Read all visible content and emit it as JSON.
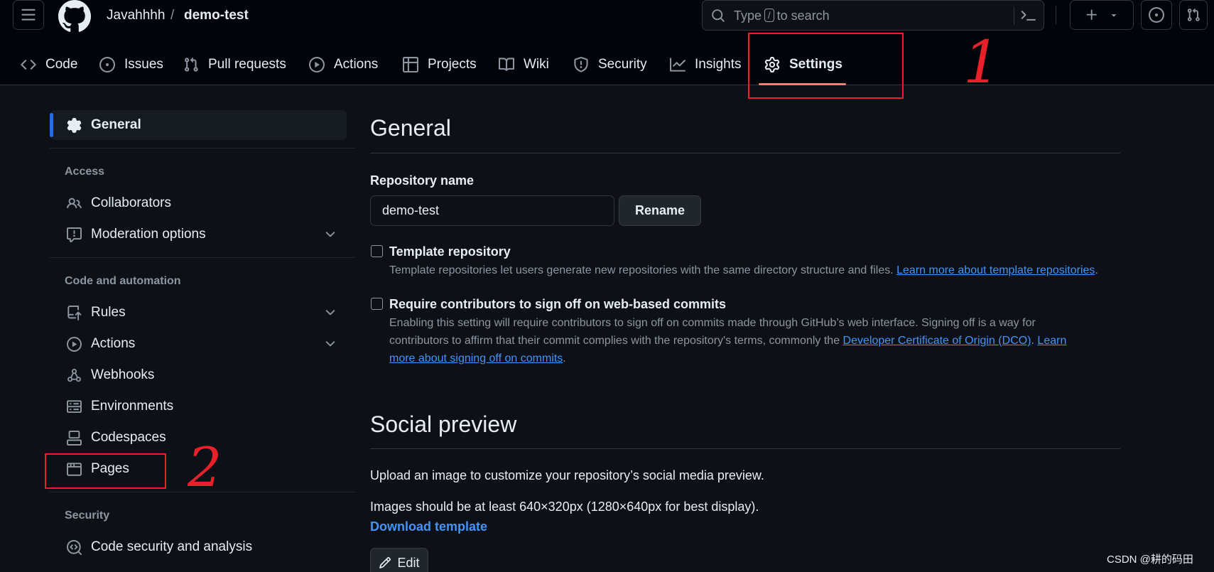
{
  "header": {
    "owner": "Javahhhh",
    "separator": "/",
    "repo": "demo-test",
    "search": {
      "prefix": "Type",
      "key": "/",
      "suffix": "to search"
    }
  },
  "nav": {
    "tabs": [
      {
        "label": "Code",
        "icon": "code-icon"
      },
      {
        "label": "Issues",
        "icon": "issue-opened-icon"
      },
      {
        "label": "Pull requests",
        "icon": "git-pull-request-icon"
      },
      {
        "label": "Actions",
        "icon": "play-icon"
      },
      {
        "label": "Projects",
        "icon": "table-icon"
      },
      {
        "label": "Wiki",
        "icon": "book-icon"
      },
      {
        "label": "Security",
        "icon": "shield-icon"
      },
      {
        "label": "Insights",
        "icon": "graph-icon"
      },
      {
        "label": "Settings",
        "icon": "gear-icon",
        "selected": true
      }
    ]
  },
  "annotations": {
    "one": "1",
    "two": "2"
  },
  "sidebar": {
    "general": "General",
    "access_heading": "Access",
    "collaborators": "Collaborators",
    "moderation": "Moderation options",
    "automation_heading": "Code and automation",
    "rules": "Rules",
    "actions": "Actions",
    "webhooks": "Webhooks",
    "environments": "Environments",
    "codespaces": "Codespaces",
    "pages": "Pages",
    "security_heading": "Security",
    "code_security": "Code security and analysis"
  },
  "main": {
    "title": "General",
    "repo_name_label": "Repository name",
    "repo_name_value": "demo-test",
    "rename_button": "Rename",
    "template": {
      "label": "Template repository",
      "note": "Template repositories let users generate new repositories with the same directory structure and files.",
      "link": "Learn more about template repositories",
      "end": "."
    },
    "signoff": {
      "label": "Require contributors to sign off on web-based commits",
      "line1": "Enabling this setting will require contributors to sign off on commits made through GitHub’s web interface. Signing off is a way for",
      "line2_pre": "contributors to affirm that their commit complies with the repository's terms, commonly the",
      "dco_link": "Developer Certificate of Origin (DCO)",
      "line2_mid": ".",
      "learn_link_a": "Learn",
      "learn_link_b": "more about signing off on commits",
      "end": "."
    },
    "social_title": "Social preview",
    "social_text1": "Upload an image to customize your repository’s social media preview.",
    "social_text2": "Images should be at least 640×320px (1280×640px for best display).",
    "download_link": "Download template",
    "edit_button": "Edit"
  },
  "watermark": "CSDN @耕的码田",
  "colors": {
    "accent": "#4493f8",
    "selected_underline": "#f78166",
    "annotation_red": "#e8202a",
    "background": "#0d1117"
  }
}
